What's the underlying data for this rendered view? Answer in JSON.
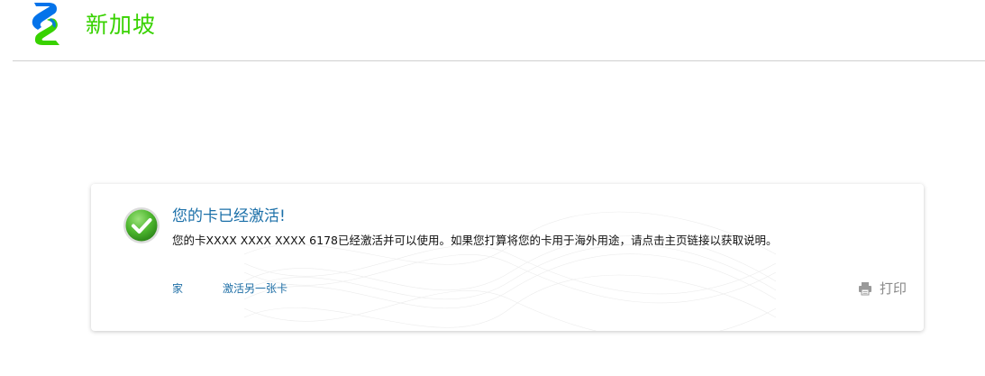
{
  "header": {
    "logo_icon": "bank-logo-icon",
    "region": "新加坡",
    "brand_colors": {
      "green": "#38d200",
      "blue": "#0473ea"
    }
  },
  "card": {
    "status_icon": "check-circle-icon",
    "title": "您的卡已经激活!",
    "message": "您的卡XXXX XXXX XXXX 6178已经激活并可以使用。如果您打算将您的卡用于海外用途，请点击主页链接以获取说明。",
    "links": {
      "home": "家",
      "activate_another": "激活另一张卡"
    },
    "print": {
      "icon": "printer-icon",
      "label": "打印"
    },
    "colors": {
      "title": "#1a6fa8",
      "link": "#1f6fa6",
      "success": "#44b02a"
    }
  }
}
